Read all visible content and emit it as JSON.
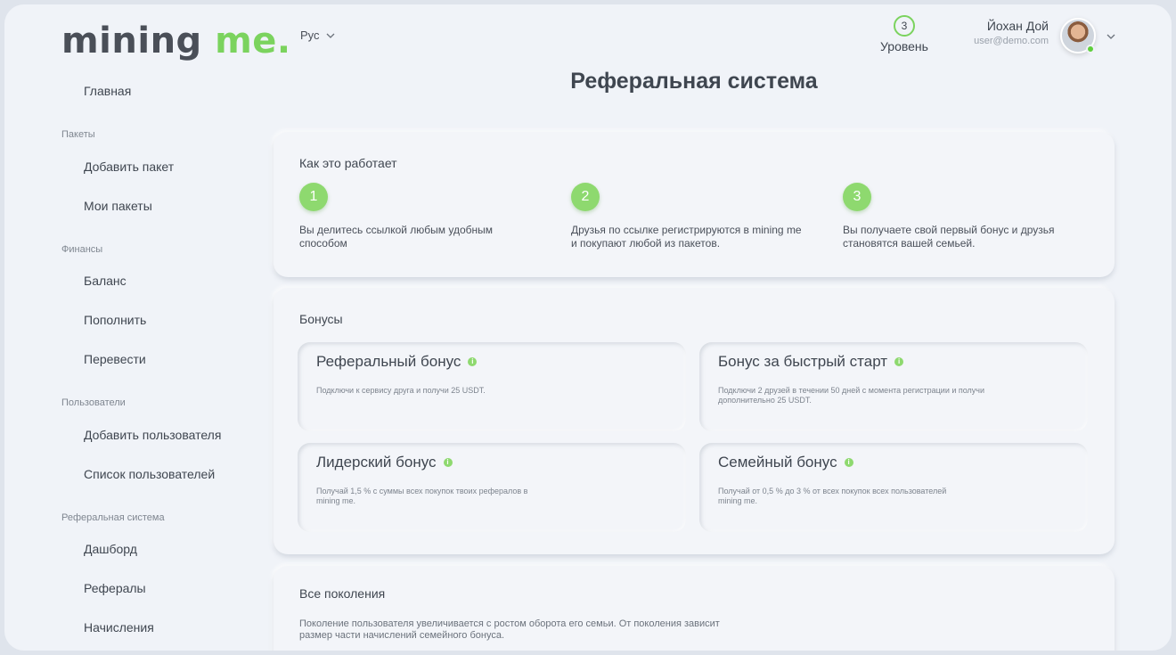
{
  "header": {
    "logo_main": "mining",
    "logo_accent": "me.",
    "language": "Рус",
    "level_number": "3",
    "level_label": "Уровень",
    "user_name": "Йохан Дой",
    "user_email": "user@demo.com"
  },
  "sidebar": {
    "home": "Главная",
    "section_packages": "Пакеты",
    "add_package": "Добавить пакет",
    "my_packages": "Мои пакеты",
    "section_finance": "Финансы",
    "balance": "Баланс",
    "top_up": "Пополнить",
    "transfer": "Перевести",
    "section_users": "Пользователи",
    "add_user": "Добавить пользователя",
    "user_list": "Список пользователей",
    "section_referral": "Реферальная система",
    "dashboard": "Дашборд",
    "referrals": "Рефералы",
    "accruals": "Начисления"
  },
  "main": {
    "title": "Реферальная система",
    "how_it_works": {
      "title": "Как это работает",
      "steps": [
        {
          "num": "1",
          "text": "Вы делитесь ссылкой любым удобным способом"
        },
        {
          "num": "2",
          "text": "Друзья по ссылке регистрируются в mining me и покупают любой из пакетов."
        },
        {
          "num": "3",
          "text": "Вы получаете свой первый бонус и друзья становятся вашей семьей."
        }
      ]
    },
    "bonuses": {
      "title": "Бонусы",
      "items": [
        {
          "title": "Реферальный бонус",
          "desc": "Подключи к сервису друга и получи 25 USDT."
        },
        {
          "title": "Бонус за быстрый старт",
          "desc": "Подключи 2 друзей в течении 50 дней с момента регистрации и получи дополнительно 25 USDT."
        },
        {
          "title": "Лидерский бонус",
          "desc": "Получай 1,5 % с суммы всех покупок твоих рефералов в mining me."
        },
        {
          "title": "Семейный бонус",
          "desc": "Получай от 0,5 % до 3 % от всех покупок всех пользователей mining me."
        }
      ]
    },
    "generations": {
      "title": "Все поколения",
      "desc": "Поколение пользователя увеличивается с ростом оборота его семьи. От поколения зависит размер части начислений семейного бонуса."
    }
  },
  "colors": {
    "accent": "#7bd35e",
    "online": "#5fcf3c",
    "background": "#f0f3f8"
  }
}
